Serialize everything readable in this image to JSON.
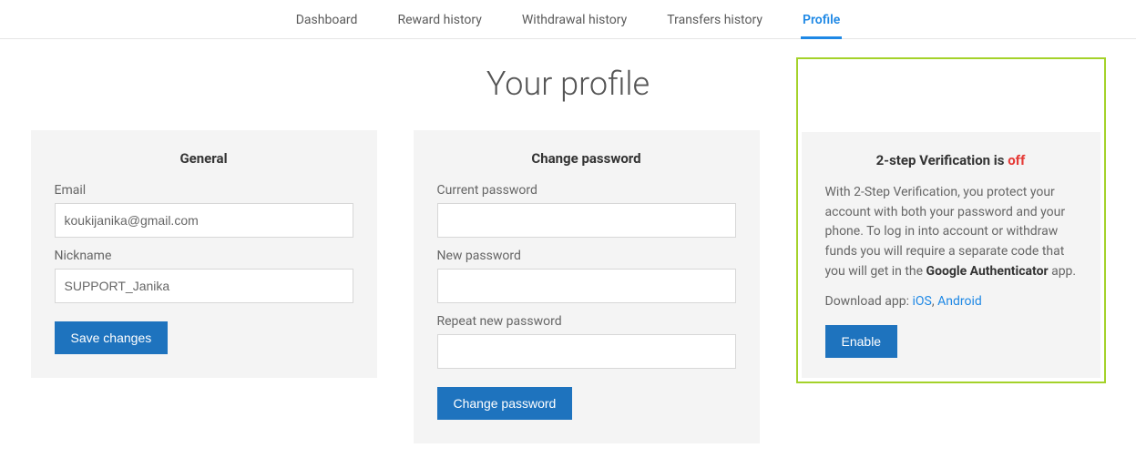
{
  "nav": {
    "items": [
      {
        "label": "Dashboard"
      },
      {
        "label": "Reward history"
      },
      {
        "label": "Withdrawal history"
      },
      {
        "label": "Transfers history"
      },
      {
        "label": "Profile"
      }
    ]
  },
  "page_title": "Your profile",
  "general": {
    "heading": "General",
    "email_label": "Email",
    "email_value": "koukijanika@gmail.com",
    "nickname_label": "Nickname",
    "nickname_value": "SUPPORT_Janika",
    "save_label": "Save changes"
  },
  "password": {
    "heading": "Change password",
    "current_label": "Current password",
    "new_label": "New password",
    "repeat_label": "Repeat new password",
    "button_label": "Change password"
  },
  "verification": {
    "title_prefix": "2-step Verification is ",
    "status": "off",
    "description_before": "With 2-Step Verification, you protect your account with both your password and your phone. To log in into account or withdraw funds you will require a separate code that you will get in the ",
    "description_strong": "Google Authenticator",
    "description_after": " app.",
    "download_prefix": "Download app: ",
    "download_ios": "iOS",
    "download_sep": ", ",
    "download_android": "Android",
    "enable_label": "Enable"
  }
}
